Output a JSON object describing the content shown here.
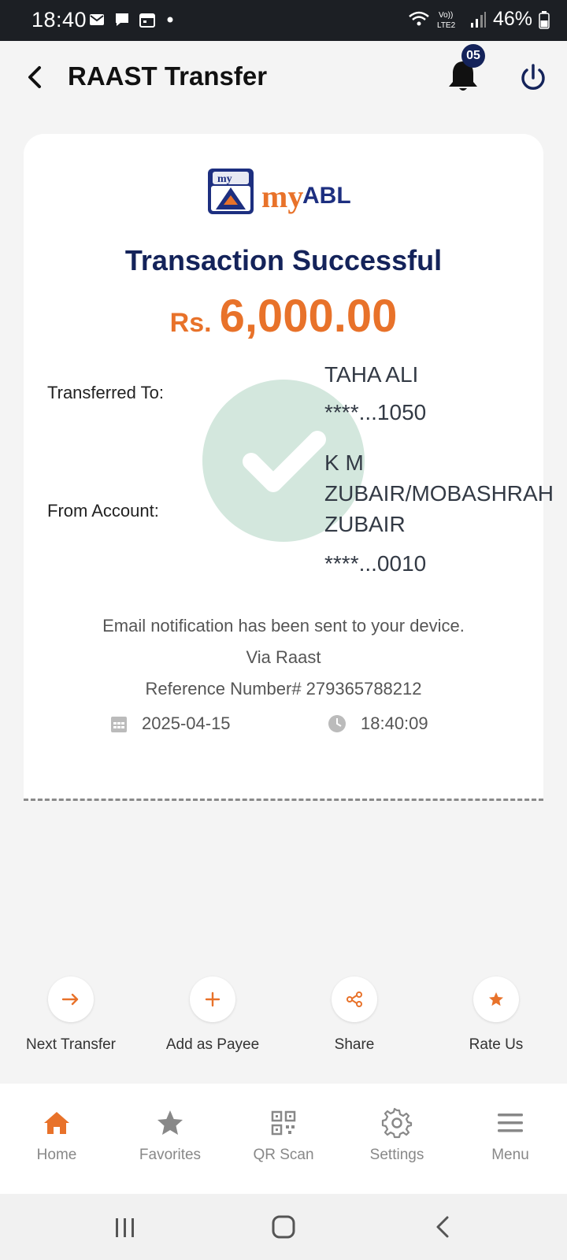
{
  "status_bar": {
    "time": "18:40",
    "battery": "46%",
    "network": "LTE2"
  },
  "header": {
    "title": "RAAST Transfer",
    "notification_count": "05"
  },
  "receipt": {
    "logo_text_my": "my",
    "logo_text_abl": "ABL",
    "title": "Transaction Successful",
    "currency": "Rs.",
    "amount": "6,000.00",
    "transferred_to_label": "Transferred To:",
    "transferred_to_name": "TAHA ALI",
    "transferred_to_account": "****...1050",
    "from_account_label": "From Account:",
    "from_account_name_line1": "K M",
    "from_account_name_line2": "ZUBAIR/MOBASHRAH",
    "from_account_name_line3": "ZUBAIR",
    "from_account_number": "****...0010",
    "email_notice": "Email notification has been sent to your device.",
    "via": "Via Raast",
    "reference": "Reference Number# 279365788212",
    "date": "2025-04-15",
    "time": "18:40:09"
  },
  "actions": [
    {
      "label": "Next Transfer",
      "icon": "arrow-right-icon"
    },
    {
      "label": "Add as Payee",
      "icon": "plus-icon"
    },
    {
      "label": "Share",
      "icon": "share-icon"
    },
    {
      "label": "Rate Us",
      "icon": "star-icon"
    }
  ],
  "bottom_nav": [
    {
      "label": "Home",
      "icon": "home-icon"
    },
    {
      "label": "Favorites",
      "icon": "star-icon"
    },
    {
      "label": "QR Scan",
      "icon": "qr-icon"
    },
    {
      "label": "Settings",
      "icon": "gear-icon"
    },
    {
      "label": "Menu",
      "icon": "menu-icon"
    }
  ],
  "colors": {
    "accent": "#e8722a",
    "brand_navy": "#14235a",
    "success_circle": "#d3e7dd"
  }
}
